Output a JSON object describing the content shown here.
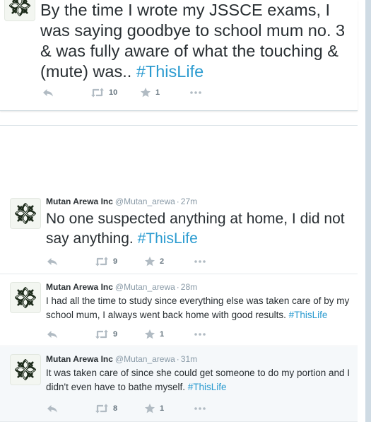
{
  "expanded_tweet": {
    "text": "By the time I wrote my JSSCE exams, I was saying goodbye to school mum no. 3 & was fully aware of what the touching & (mute) was.. ",
    "hashtag": "#ThisLife",
    "retweets": "10",
    "favorites": "1"
  },
  "tweets": [
    {
      "name": "Mutan Arewa Inc",
      "handle": "@Mutan_arewa",
      "separator": "·",
      "time": "27m",
      "text": "No one suspected anything at home, I did not say anything. ",
      "hashtag": "#ThisLife",
      "retweets": "9",
      "favorites": "2"
    },
    {
      "name": "Mutan Arewa Inc",
      "handle": "@Mutan_arewa",
      "separator": "·",
      "time": "28m",
      "text": "I had all the time to study since everything else was taken care of by my school mum, I always went back home with good results. ",
      "hashtag": "#ThisLife",
      "retweets": "9",
      "favorites": "1"
    },
    {
      "name": "Mutan Arewa Inc",
      "handle": "@Mutan_arewa",
      "separator": "·",
      "time": "31m",
      "text": "It was taken care of since she could get someone to do my portion and I didn't even have to bathe myself. ",
      "hashtag": "#ThisLife",
      "retweets": "8",
      "favorites": "1"
    }
  ],
  "icons": {
    "avatar": "arewa-knot-logo-icon",
    "reply": "reply-icon",
    "retweet": "retweet-icon",
    "favorite": "star-icon",
    "more": "more-dots-icon"
  },
  "colors": {
    "hashtag": "#2b9bd0",
    "action_icon": "#b1bbc3",
    "logo": "#1c2a1a",
    "alt_row_bg": "#f5f8fa"
  }
}
